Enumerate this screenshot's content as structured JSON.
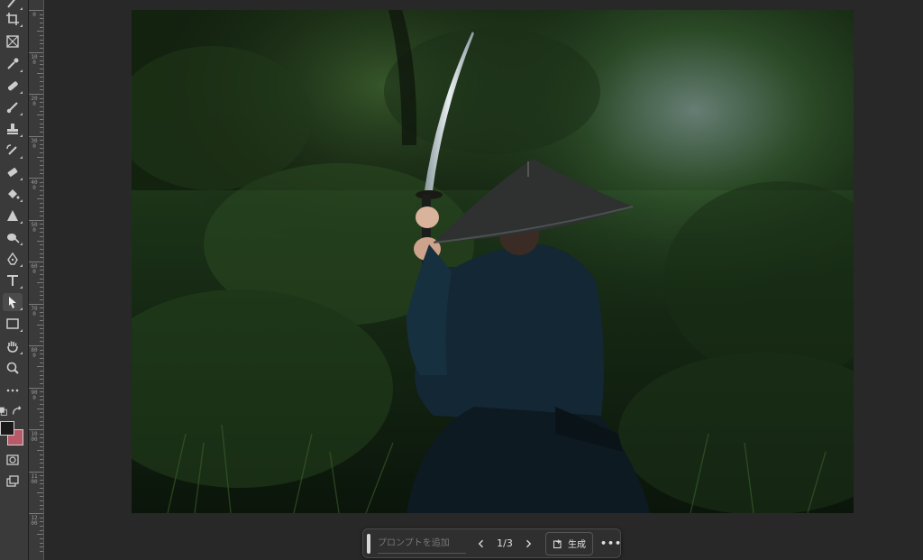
{
  "toolbar": {
    "tools": [
      {
        "name": "brush-tool-icon",
        "active": false
      },
      {
        "name": "crop-tool-icon",
        "active": false
      },
      {
        "name": "frame-tool-icon",
        "active": false
      },
      {
        "name": "eyedropper-tool-icon",
        "active": false
      },
      {
        "name": "spot-healing-tool-icon",
        "active": false
      },
      {
        "name": "brush-icon",
        "active": false
      },
      {
        "name": "clone-stamp-tool-icon",
        "active": false
      },
      {
        "name": "history-brush-tool-icon",
        "active": false
      },
      {
        "name": "eraser-tool-icon",
        "active": false
      },
      {
        "name": "paint-bucket-tool-icon",
        "active": false
      },
      {
        "name": "sharpen-tool-icon",
        "active": false
      },
      {
        "name": "dodge-tool-icon",
        "active": false
      },
      {
        "name": "pen-tool-icon",
        "active": false
      },
      {
        "name": "type-tool-icon",
        "active": false
      },
      {
        "name": "path-selection-tool-icon",
        "active": true
      },
      {
        "name": "rectangle-tool-icon",
        "active": false
      },
      {
        "name": "hand-tool-icon",
        "active": false
      },
      {
        "name": "zoom-tool-icon",
        "active": false
      },
      {
        "name": "more-tools-icon",
        "active": false
      }
    ],
    "foreground_color": "#1a1a1a",
    "background_color": "#b85a6a"
  },
  "ruler": {
    "labels": [
      "0",
      "100",
      "200",
      "300",
      "400",
      "500",
      "600",
      "700",
      "800",
      "900",
      "1000",
      "1100",
      "1200"
    ]
  },
  "taskbar": {
    "prompt_placeholder": "プロンプトを追加",
    "page_indicator": "1/3",
    "generate_label": "生成",
    "more_label": "•••"
  }
}
